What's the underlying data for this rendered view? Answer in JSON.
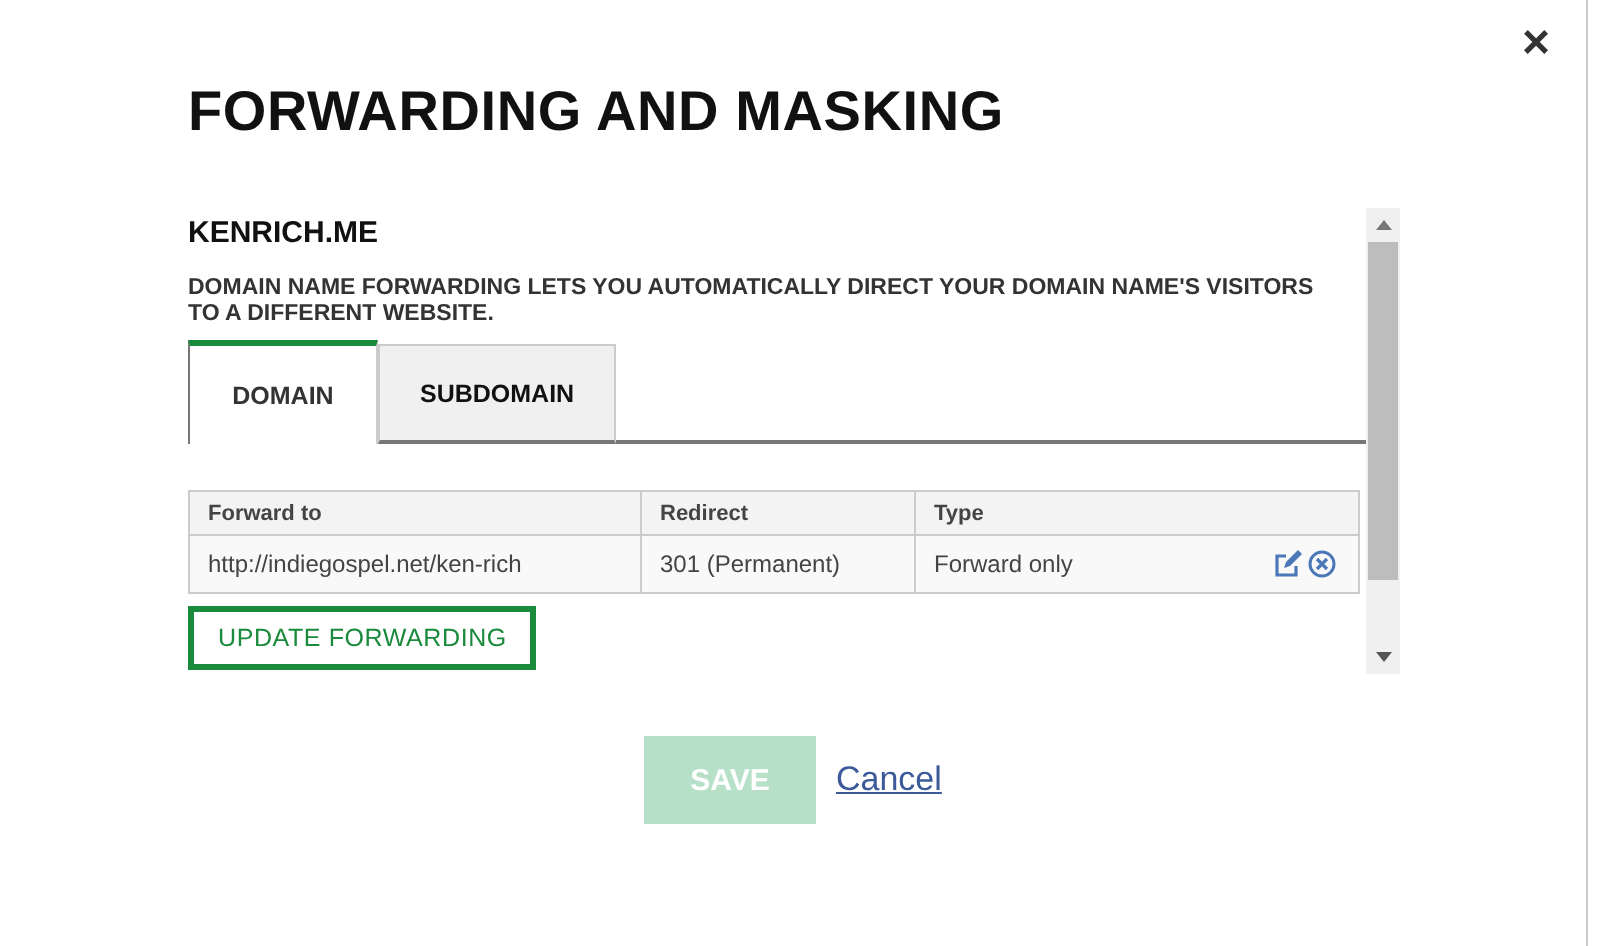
{
  "dialog": {
    "title": "FORWARDING AND MASKING",
    "close": "×"
  },
  "domain": "KENRICH.ME",
  "description": "DOMAIN NAME FORWARDING LETS YOU AUTOMATICALLY DIRECT YOUR DOMAIN NAME'S VISITORS TO A DIFFERENT WEBSITE.",
  "tabs": [
    {
      "label": "DOMAIN",
      "selected": true
    },
    {
      "label": "SUBDOMAIN",
      "selected": false
    }
  ],
  "table": {
    "columns": [
      "Forward to",
      "Redirect",
      "Type"
    ],
    "rows": [
      {
        "cells": [
          "http://indiegospel.net/ken-rich",
          "301 (Permanent)",
          "Forward only"
        ]
      }
    ]
  },
  "update_button": "UPDATE FORWARDING",
  "save_button": {
    "label": "SAVE",
    "disabled": true
  },
  "cancel_link": "Cancel"
}
